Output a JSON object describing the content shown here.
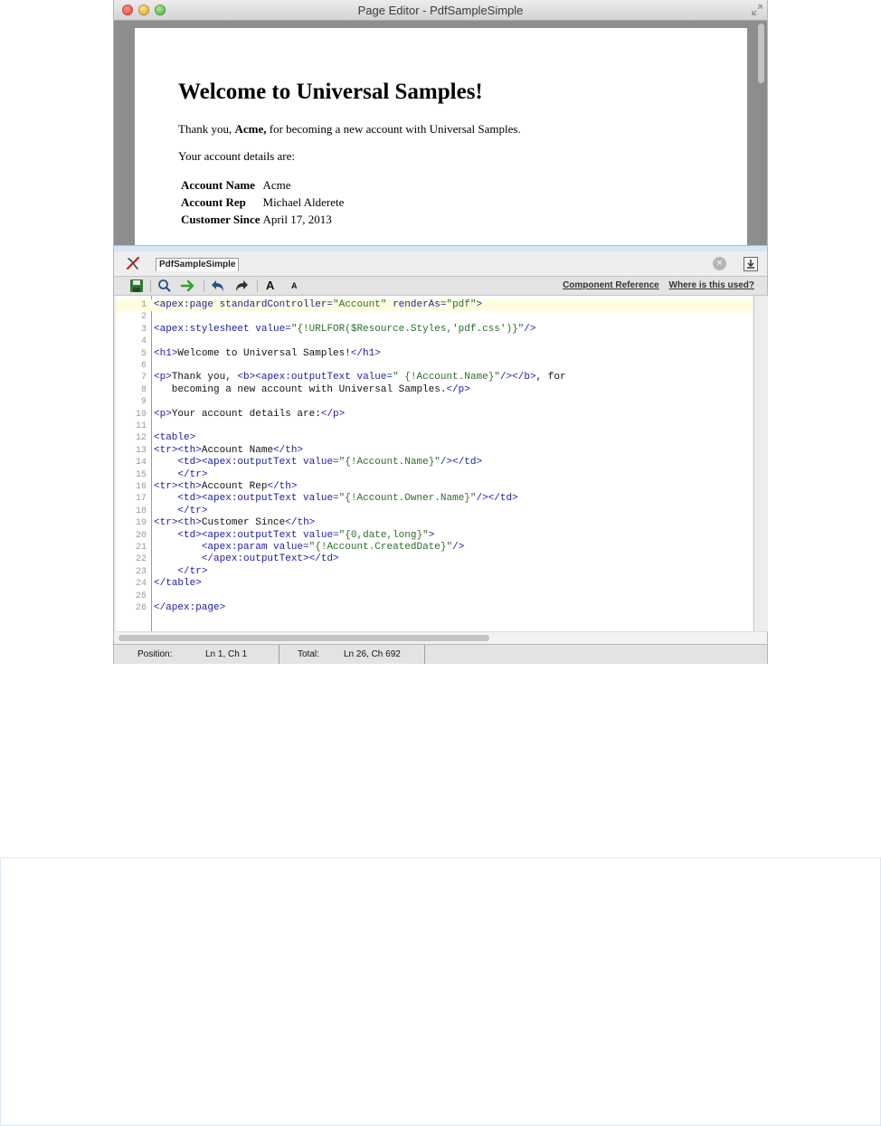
{
  "window": {
    "title": "Page Editor - PdfSampleSimple"
  },
  "preview": {
    "heading": "Welcome to Universal Samples!",
    "intro_before": "Thank you, ",
    "intro_name": "Acme,",
    "intro_after": " for becoming a new account with Universal Samples.",
    "details_text": "Your account details are:",
    "rows": [
      {
        "label": "Account Name",
        "value": "Acme"
      },
      {
        "label": "Account Rep",
        "value": "Michael Alderete"
      },
      {
        "label": "Customer Since",
        "value": "April 17, 2013"
      }
    ]
  },
  "editor": {
    "tab_label": "PdfSampleSimple",
    "links": {
      "component_reference": "Component Reference",
      "where_used": "Where is this used?"
    },
    "font_larger": "A",
    "font_smaller": "A",
    "lines": [
      "<apex:page standardController=\"Account\" renderAs=\"pdf\">",
      "",
      "<apex:stylesheet value=\"{!URLFOR($Resource.Styles,'pdf.css')}\"/>",
      "",
      "<h1>Welcome to Universal Samples!</h1>",
      "",
      "<p>Thank you, <b><apex:outputText value=\" {!Account.Name}\"/></b>, for",
      "   becoming a new account with Universal Samples.</p>",
      "",
      "<p>Your account details are:</p>",
      "",
      "<table>",
      "<tr><th>Account Name</th>",
      "    <td><apex:outputText value=\"{!Account.Name}\"/></td>",
      "    </tr>",
      "<tr><th>Account Rep</th>",
      "    <td><apex:outputText value=\"{!Account.Owner.Name}\"/></td>",
      "    </tr>",
      "<tr><th>Customer Since</th>",
      "    <td><apex:outputText value=\"{0,date,long}\">",
      "        <apex:param value=\"{!Account.CreatedDate}\"/>",
      "        </apex:outputText></td>",
      "    </tr>",
      "</table>",
      "",
      "</apex:page>"
    ]
  },
  "status": {
    "position_label": "Position:",
    "position_value": "Ln 1, Ch 1",
    "total_label": "Total:",
    "total_value": "Ln 26, Ch 692"
  },
  "colors": {
    "active_line": "#fffde0",
    "tag": "#1a1aa6",
    "string": "#2a6e2a"
  }
}
